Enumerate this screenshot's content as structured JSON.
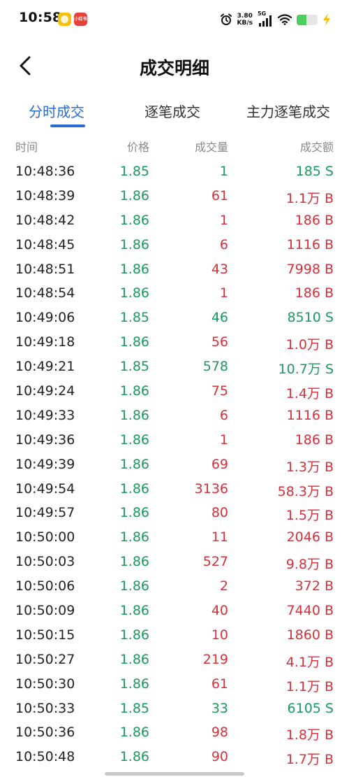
{
  "status_bar": {
    "time": "10:58",
    "app_icon_2_text": "小红书",
    "net_speed_value": "3.80",
    "net_speed_unit": "KB/s",
    "network_type": "5G",
    "battery_level": 0.45
  },
  "header": {
    "title": "成交明细"
  },
  "tabs": [
    {
      "label": "分时成交",
      "active": true
    },
    {
      "label": "逐笔成交",
      "active": false
    },
    {
      "label": "主力逐笔成交",
      "active": false
    }
  ],
  "table": {
    "columns": [
      "时间",
      "价格",
      "成交量",
      "成交额"
    ],
    "rows": [
      {
        "time": "10:48:36",
        "price": "1.85",
        "volume": "1",
        "amount": "185 S",
        "side": "S"
      },
      {
        "time": "10:48:39",
        "price": "1.86",
        "volume": "61",
        "amount": "1.1万 B",
        "side": "B"
      },
      {
        "time": "10:48:42",
        "price": "1.86",
        "volume": "1",
        "amount": "186 B",
        "side": "B"
      },
      {
        "time": "10:48:45",
        "price": "1.86",
        "volume": "6",
        "amount": "1116 B",
        "side": "B"
      },
      {
        "time": "10:48:51",
        "price": "1.86",
        "volume": "43",
        "amount": "7998 B",
        "side": "B"
      },
      {
        "time": "10:48:54",
        "price": "1.86",
        "volume": "1",
        "amount": "186 B",
        "side": "B"
      },
      {
        "time": "10:49:06",
        "price": "1.85",
        "volume": "46",
        "amount": "8510 S",
        "side": "S"
      },
      {
        "time": "10:49:18",
        "price": "1.86",
        "volume": "56",
        "amount": "1.0万 B",
        "side": "B"
      },
      {
        "time": "10:49:21",
        "price": "1.85",
        "volume": "578",
        "amount": "10.7万 S",
        "side": "S"
      },
      {
        "time": "10:49:24",
        "price": "1.86",
        "volume": "75",
        "amount": "1.4万 B",
        "side": "B"
      },
      {
        "time": "10:49:33",
        "price": "1.86",
        "volume": "6",
        "amount": "1116 B",
        "side": "B"
      },
      {
        "time": "10:49:36",
        "price": "1.86",
        "volume": "1",
        "amount": "186 B",
        "side": "B"
      },
      {
        "time": "10:49:39",
        "price": "1.86",
        "volume": "69",
        "amount": "1.3万 B",
        "side": "B"
      },
      {
        "time": "10:49:54",
        "price": "1.86",
        "volume": "3136",
        "amount": "58.3万 B",
        "side": "B"
      },
      {
        "time": "10:49:57",
        "price": "1.86",
        "volume": "80",
        "amount": "1.5万 B",
        "side": "B"
      },
      {
        "time": "10:50:00",
        "price": "1.86",
        "volume": "11",
        "amount": "2046 B",
        "side": "B"
      },
      {
        "time": "10:50:03",
        "price": "1.86",
        "volume": "527",
        "amount": "9.8万 B",
        "side": "B"
      },
      {
        "time": "10:50:06",
        "price": "1.86",
        "volume": "2",
        "amount": "372 B",
        "side": "B"
      },
      {
        "time": "10:50:09",
        "price": "1.86",
        "volume": "40",
        "amount": "7440 B",
        "side": "B"
      },
      {
        "time": "10:50:15",
        "price": "1.86",
        "volume": "10",
        "amount": "1860 B",
        "side": "B"
      },
      {
        "time": "10:50:27",
        "price": "1.86",
        "volume": "219",
        "amount": "4.1万 B",
        "side": "B"
      },
      {
        "time": "10:50:30",
        "price": "1.86",
        "volume": "61",
        "amount": "1.1万 B",
        "side": "B"
      },
      {
        "time": "10:50:33",
        "price": "1.85",
        "volume": "33",
        "amount": "6105 S",
        "side": "S"
      },
      {
        "time": "10:50:36",
        "price": "1.86",
        "volume": "98",
        "amount": "1.8万 B",
        "side": "B"
      },
      {
        "time": "10:50:48",
        "price": "1.86",
        "volume": "90",
        "amount": "1.7万 B",
        "side": "B"
      }
    ]
  },
  "colors": {
    "accent": "#2a6bd8",
    "buy": "#d8303a",
    "sell": "#1a9a5c",
    "price": "#1a9a5c"
  },
  "icons": {
    "back": "chevron-left-icon",
    "alarm": "alarm-icon",
    "signal": "signal-icon",
    "wifi": "wifi-icon",
    "battery": "battery-icon",
    "charging": "lightning-icon"
  }
}
